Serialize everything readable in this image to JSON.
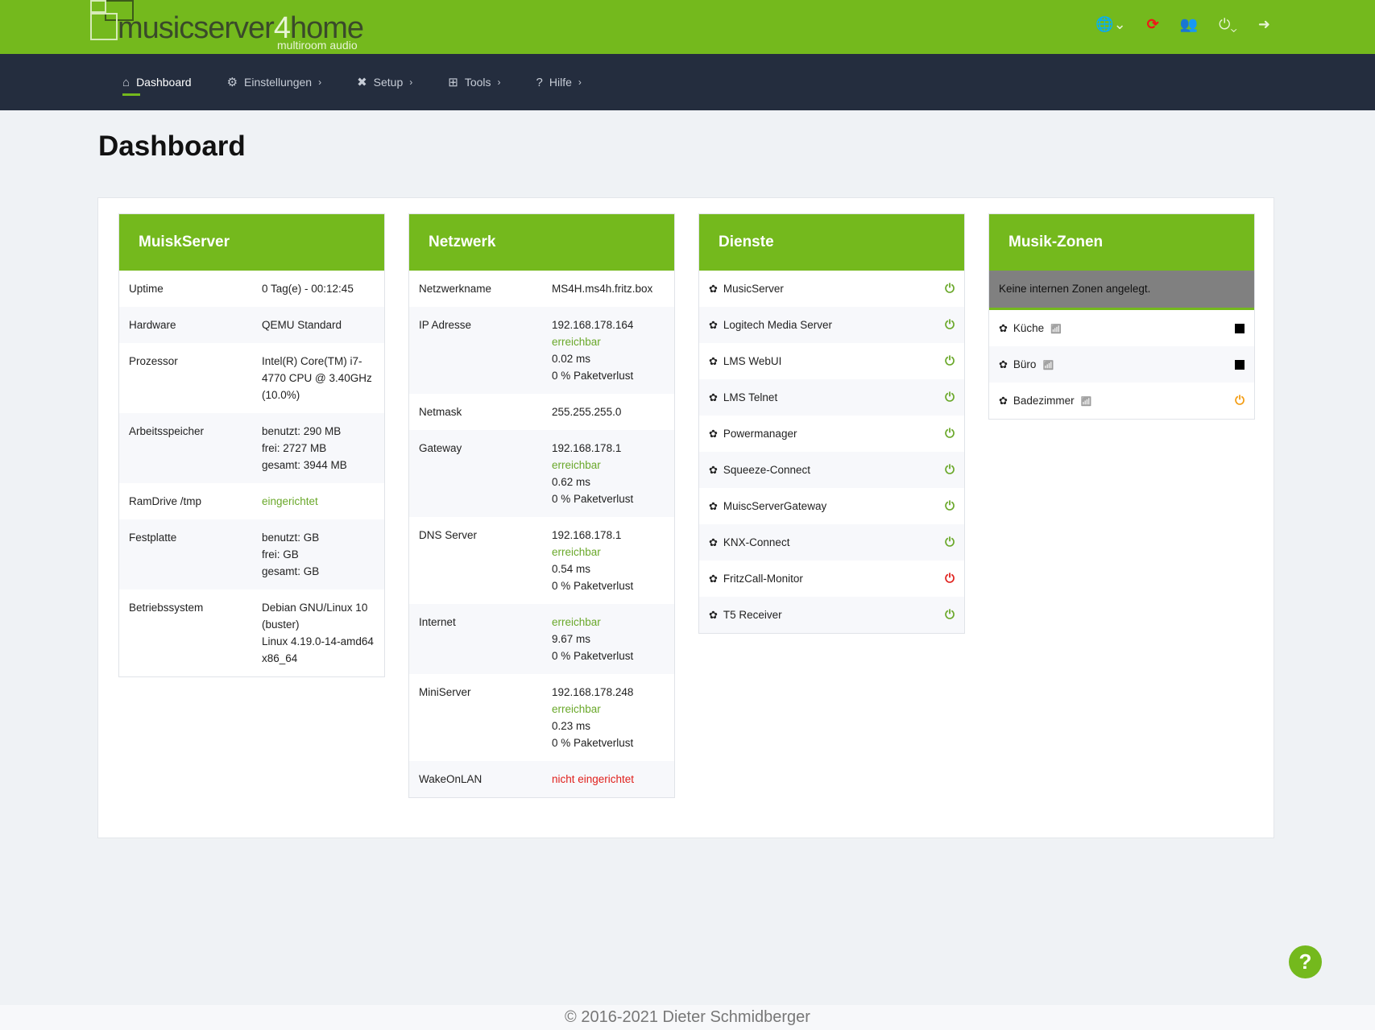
{
  "logo": {
    "name_a": "musicserver",
    "name_b": "4",
    "name_c": "home",
    "sub": "multiroom audio"
  },
  "top_icons": {
    "language": "🌐⌄",
    "refresh": "⟳",
    "users": "👥",
    "power": "⏻⌄",
    "logout": "➜"
  },
  "nav": [
    {
      "icon": "⌂",
      "label": "Dashboard"
    },
    {
      "icon": "⚙",
      "label": "Einstellungen",
      "chev": "›"
    },
    {
      "icon": "✖",
      "label": "Setup",
      "chev": "›"
    },
    {
      "icon": "⊞",
      "label": "Tools",
      "chev": "›"
    },
    {
      "icon": "?",
      "label": "Hilfe",
      "chev": "›"
    }
  ],
  "page_title": "Dashboard",
  "musicserver": {
    "title": "MuiskServer",
    "rows": [
      {
        "label": "Uptime",
        "value": [
          "0 Tag(e) - 00:12:45"
        ]
      },
      {
        "label": "Hardware",
        "value": [
          "QEMU Standard"
        ]
      },
      {
        "label": "Prozessor",
        "value": [
          "Intel(R) Core(TM) i7-4770 CPU @ 3.40GHz (10.0%)"
        ]
      },
      {
        "label": "Arbeitsspeicher",
        "value": [
          "benutzt: 290 MB",
          "frei: 2727 MB",
          "gesamt: 3944 MB"
        ]
      },
      {
        "label": "RamDrive /tmp",
        "value": [
          "eingerichtet"
        ],
        "status": "g"
      },
      {
        "label": "Festplatte",
        "value": [
          "benutzt: GB",
          "frei: GB",
          "gesamt: GB"
        ]
      },
      {
        "label": "Betriebssystem",
        "value": [
          "Debian GNU/Linux 10 (buster)",
          "Linux 4.19.0-14-amd64 x86_64"
        ]
      }
    ]
  },
  "network": {
    "title": "Netzwerk",
    "rows": [
      {
        "label": "Netzwerkname",
        "value": [
          "MS4H.ms4h.fritz.box"
        ]
      },
      {
        "label": "IP Adresse",
        "value": [
          "192.168.178.164",
          "erreichbar",
          "0.02 ms",
          "0 % Paketverlust"
        ]
      },
      {
        "label": "Netmask",
        "value": [
          "255.255.255.0"
        ]
      },
      {
        "label": "Gateway",
        "value": [
          "192.168.178.1",
          "erreichbar",
          "0.62 ms",
          "0 % Paketverlust"
        ]
      },
      {
        "label": "DNS Server",
        "value": [
          "192.168.178.1",
          "erreichbar",
          "0.54 ms",
          "0 % Paketverlust"
        ]
      },
      {
        "label": "Internet",
        "value": [
          "erreichbar",
          "9.67 ms",
          "0 % Paketverlust"
        ]
      },
      {
        "label": "MiniServer",
        "value": [
          "192.168.178.248",
          "erreichbar",
          "0.23 ms",
          "0 % Paketverlust"
        ]
      },
      {
        "label": "WakeOnLAN",
        "value": [
          "nicht eingerichtet"
        ],
        "status": "r"
      }
    ]
  },
  "services": {
    "title": "Dienste",
    "items": [
      {
        "name": "MusicServer",
        "status": "on"
      },
      {
        "name": "Logitech Media Server",
        "status": "on"
      },
      {
        "name": "LMS WebUI",
        "status": "on"
      },
      {
        "name": "LMS Telnet",
        "status": "on"
      },
      {
        "name": "Powermanager",
        "status": "on"
      },
      {
        "name": "Squeeze-Connect",
        "status": "on"
      },
      {
        "name": "MuiscServerGateway",
        "status": "on"
      },
      {
        "name": "KNX-Connect",
        "status": "on"
      },
      {
        "name": "FritzCall-Monitor",
        "status": "off"
      },
      {
        "name": "T5 Receiver",
        "status": "on"
      }
    ]
  },
  "zones": {
    "title": "Musik-Zonen",
    "notice": "Keine internen Zonen angelegt.",
    "items": [
      {
        "name": "Küche",
        "state": "stop"
      },
      {
        "name": "Büro",
        "state": "stop"
      },
      {
        "name": "Badezimmer",
        "state": "power"
      }
    ]
  },
  "colors": {
    "green": "#74b91d",
    "on": "#6aa82a",
    "off": "#e0201c",
    "standby": "#f39c12"
  },
  "help": "?",
  "footer": "© 2016-2021 Dieter Schmidberger"
}
